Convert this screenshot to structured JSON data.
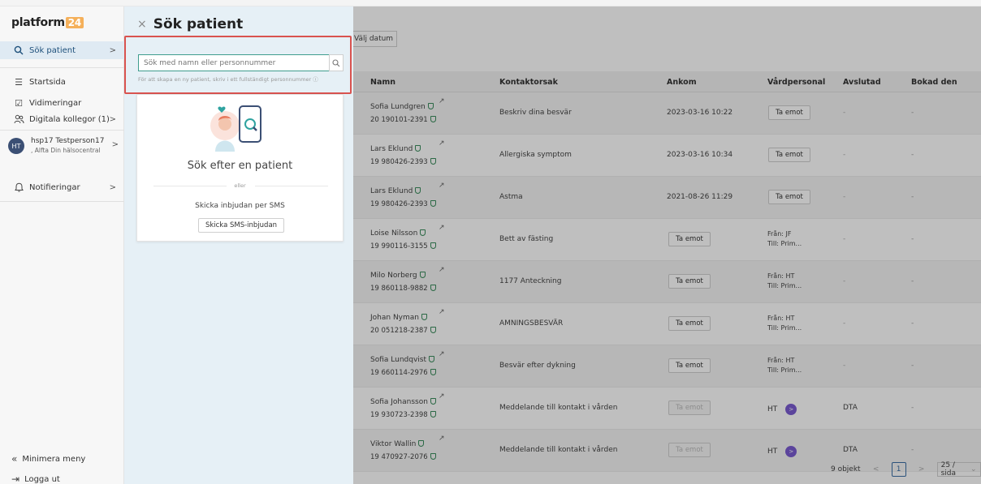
{
  "sidebar": {
    "logo_text": "platform",
    "logo_badge": "24",
    "items": [
      {
        "label": "Sök patient",
        "icon": "search-icon"
      },
      {
        "label": "Startsida",
        "icon": "list-icon"
      },
      {
        "label": "Vidimeringar",
        "icon": "checkbox-icon"
      },
      {
        "label": "Digitala kollegor (1)",
        "icon": "people-icon"
      },
      {
        "label": "Notifieringar",
        "icon": "bell-icon"
      }
    ],
    "user": {
      "initials": "HT",
      "name": "hsp17 Testperson17",
      "unit": ", Alfta Din hälsocentral"
    },
    "minimize_label": "Minimera meny",
    "logout_label": "Logga ut"
  },
  "search_panel": {
    "title": "Sök patient",
    "placeholder": "Sök med namn eller personnummer",
    "hint": "För att skapa en ny patient, skriv i ett fullständigt personnummer",
    "card_title": "Sök efter en patient",
    "or_label": "eller",
    "sms_label": "Skicka inbjudan per SMS",
    "sms_button": "Skicka SMS-inbjudan"
  },
  "main": {
    "date_button": "Välj datum",
    "columns": {
      "name": "Namn",
      "reason": "Kontaktorsak",
      "ankom": "Ankom",
      "vardpersonal": "Vårdpersonal",
      "avslutad": "Avslutad",
      "bokad": "Bokad den"
    },
    "accept_label": "Ta emot",
    "rows": [
      {
        "name": "Sofia Lundgren",
        "pnr": "20 190101-2391",
        "reason": "Beskriv dina besvär",
        "ankom": "2023-03-16 10:22",
        "from": "",
        "to": "",
        "vp": "",
        "avslutad": "-",
        "bokad": "-"
      },
      {
        "name": "Lars Eklund",
        "pnr": "19 980426-2393",
        "reason": "Allergiska symptom",
        "ankom": "2023-03-16 10:34",
        "from": "",
        "to": "",
        "vp": "",
        "avslutad": "-",
        "bokad": "-"
      },
      {
        "name": "Lars Eklund",
        "pnr": "19 980426-2393",
        "reason": "Astma",
        "ankom": "2021-08-26 11:29",
        "from": "",
        "to": "",
        "vp": "",
        "avslutad": "-",
        "bokad": "-"
      },
      {
        "name": "Loise Nilsson",
        "pnr": "19 990116-3155",
        "reason": "Bett av fästing",
        "ankom": "",
        "from": "Från: JF",
        "to": "Till: Prim...",
        "vp": "",
        "avslutad": "-",
        "bokad": "-"
      },
      {
        "name": "Milo Norberg",
        "pnr": "19 860118-9882",
        "reason": "1177 Anteckning",
        "ankom": "",
        "from": "Från: HT",
        "to": "Till: Prim...",
        "vp": "",
        "avslutad": "-",
        "bokad": "-"
      },
      {
        "name": "Johan Nyman",
        "pnr": "20 051218-2387",
        "reason": "AMNINGSBESVÄR",
        "ankom": "",
        "from": "Från: HT",
        "to": "Till: Prim...",
        "vp": "",
        "avslutad": "-",
        "bokad": "-"
      },
      {
        "name": "Sofia Lundqvist",
        "pnr": "19 660114-2976",
        "reason": "Besvär efter dykning",
        "ankom": "",
        "from": "Från: HT",
        "to": "Till: Prim...",
        "vp": "",
        "avslutad": "-",
        "bokad": "-"
      },
      {
        "name": "Sofia Johansson",
        "pnr": "19 930723-2398",
        "reason": "Meddelande till kontakt i vården",
        "ankom": "",
        "from": "",
        "to": "",
        "vp": "HT",
        "avslutad": "DTA",
        "bokad": "-"
      },
      {
        "name": "Viktor Wallin",
        "pnr": "19 470927-2076",
        "reason": "Meddelande till kontakt i vården",
        "ankom": "",
        "from": "",
        "to": "",
        "vp": "HT",
        "avslutad": "DTA",
        "bokad": "-"
      }
    ],
    "pager": {
      "count": "9 objekt",
      "prev": "<",
      "page": "1",
      "next": ">",
      "size": "25 / sida"
    }
  }
}
